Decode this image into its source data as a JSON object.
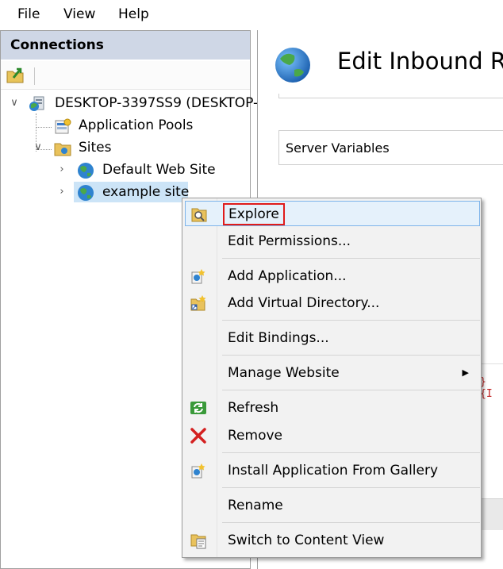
{
  "menubar": {
    "items": [
      "File",
      "View",
      "Help"
    ]
  },
  "connections": {
    "header": "Connections",
    "tree": {
      "server": "DESKTOP-3397SS9 (DESKTOP-",
      "app_pools": "Application Pools",
      "sites": "Sites",
      "default_site": "Default Web Site",
      "example_site": "example site"
    }
  },
  "main": {
    "title": "Edit Inbound Ru",
    "server_variables": "Server Variables",
    "code_fragment": "} {I"
  },
  "context_menu": {
    "items": [
      {
        "label": "Explore",
        "icon": "explore-icon",
        "selected": true
      },
      {
        "label": "Edit Permissions...",
        "icon": ""
      },
      {
        "label": "Add Application...",
        "icon": "add-application-icon"
      },
      {
        "label": "Add Virtual Directory...",
        "icon": "add-virtual-directory-icon"
      },
      {
        "label": "Edit Bindings...",
        "icon": ""
      },
      {
        "label": "Manage Website",
        "icon": "",
        "submenu": true
      },
      {
        "label": "Refresh",
        "icon": "refresh-icon"
      },
      {
        "label": "Remove",
        "icon": "remove-icon"
      },
      {
        "label": "Install Application From Gallery",
        "icon": "gallery-icon"
      },
      {
        "label": "Rename",
        "icon": ""
      },
      {
        "label": "Switch to Content View",
        "icon": "content-view-icon"
      }
    ]
  },
  "colors": {
    "panel_header": "#cfd7e6",
    "selection": "#e5f1fb",
    "selection_border": "#7eb4ea",
    "highlight_box": "#e01b1b",
    "remove_red": "#d42020",
    "refresh_green": "#2c8a2c"
  }
}
